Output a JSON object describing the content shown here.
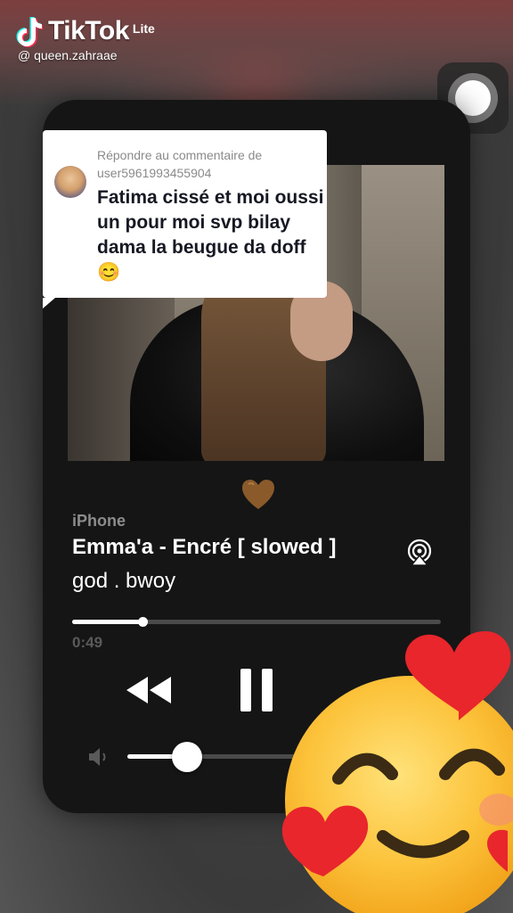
{
  "app": {
    "logo_text": "TikTok",
    "logo_suffix": "Lite",
    "handle": "@ queen.zahraae"
  },
  "comment": {
    "reply_label": "Répondre au commentaire de user5961993455904",
    "text": "Fatima cissé et moi oussi un pour moi svp bilay dama la beugue da doff 😊"
  },
  "player": {
    "device": "iPhone",
    "track_title": "Emma'a - Encré [ slowed ]",
    "artist": "god . bwoy",
    "elapsed": "0:49",
    "progress": 0.19,
    "volume": 0.21
  },
  "icons": {
    "heart": "brown-heart-icon",
    "airplay": "airplay-icon",
    "rewind": "rewind-icon",
    "pause": "pause-icon",
    "volume": "volume-low-icon",
    "emoji": "smiling-face-with-hearts-icon",
    "assistive": "assistive-touch-icon"
  },
  "colors": {
    "card": "#151515",
    "heart": "#8a5a2b",
    "track": "#4a4a4a"
  }
}
